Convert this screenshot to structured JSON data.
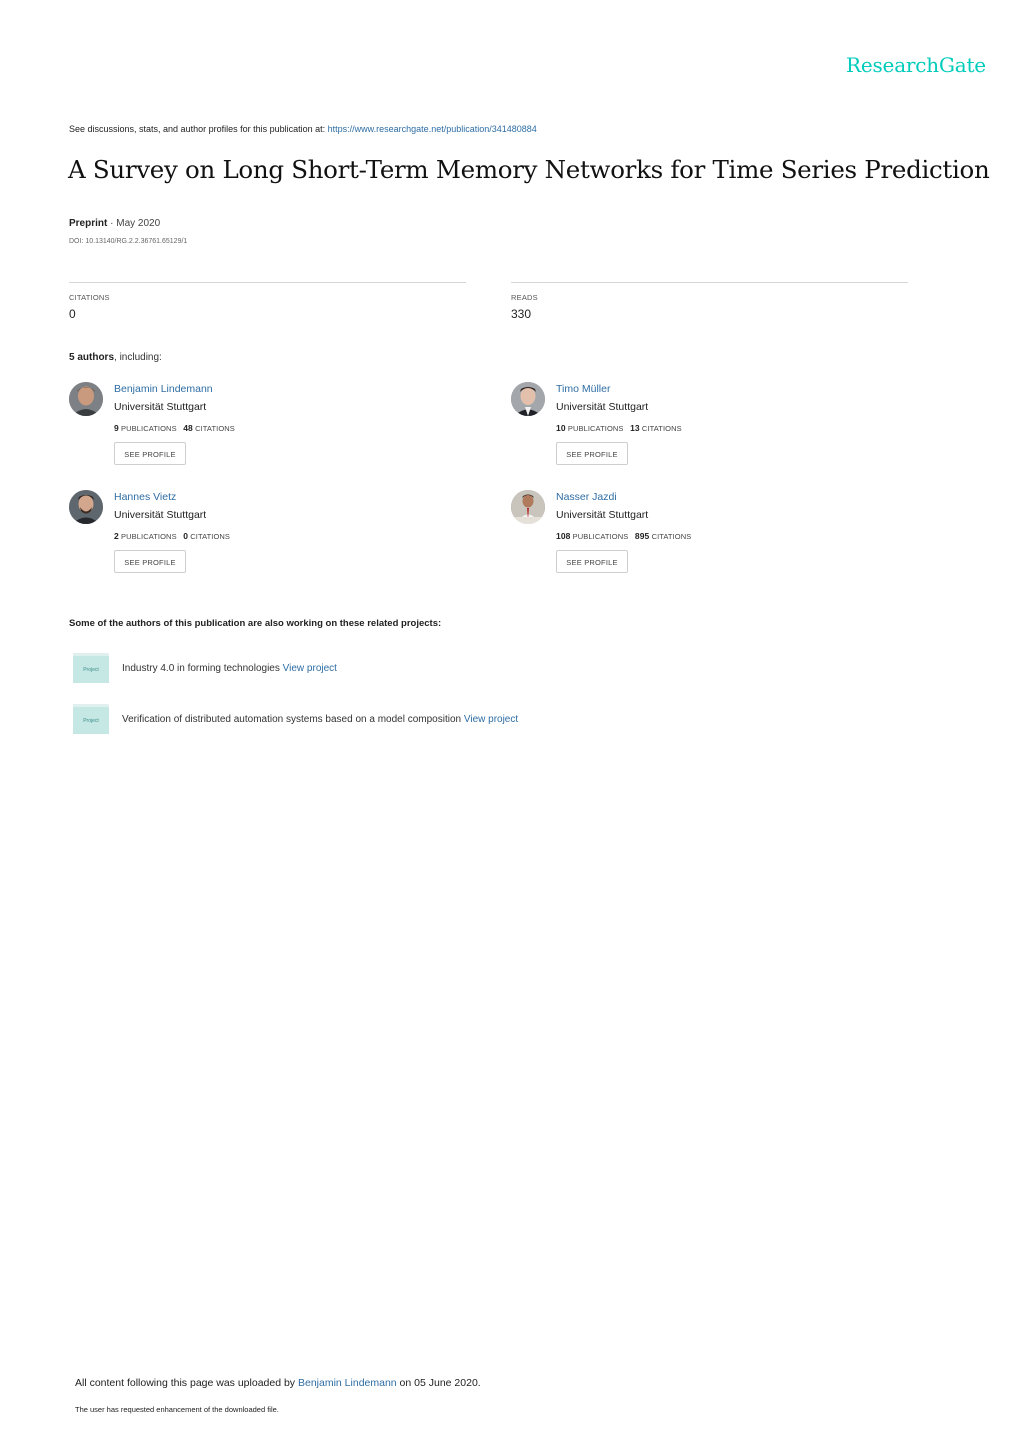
{
  "brand": {
    "logo_text": "ResearchGate",
    "accent_color": "#00ccbb",
    "link_color": "#2e6da4"
  },
  "header": {
    "see_discussions_text": "See discussions, stats, and author profiles for this publication at: ",
    "publication_url": "https://www.researchgate.net/publication/341480884"
  },
  "publication": {
    "title": "A Survey on Long Short-Term Memory Networks for Time Series Prediction",
    "type": "Preprint",
    "date_sep": " · ",
    "date": "May 2020",
    "doi": "DOI: 10.13140/RG.2.2.36761.65129/1"
  },
  "stats": {
    "citations_label": "CITATIONS",
    "citations_value": "0",
    "reads_label": "READS",
    "reads_value": "330"
  },
  "authors_section": {
    "count_bold": "5 authors",
    "suffix": ", including:",
    "publications_label": "PUBLICATIONS",
    "citations_label": "CITATIONS",
    "see_profile_label": "SEE PROFILE",
    "authors": [
      {
        "name": "Benjamin Lindemann",
        "institution": "Universität Stuttgart",
        "publications": "9",
        "citations": "48"
      },
      {
        "name": "Timo Müller",
        "institution": "Universität Stuttgart",
        "publications": "10",
        "citations": "13"
      },
      {
        "name": "Hannes Vietz",
        "institution": "Universität Stuttgart",
        "publications": "2",
        "citations": "0"
      },
      {
        "name": "Nasser Jazdi",
        "institution": "Universität Stuttgart",
        "publications": "108",
        "citations": "895"
      }
    ]
  },
  "projects_section": {
    "heading": "Some of the authors of this publication are also working on these related projects:",
    "icon_label": "Project",
    "view_label": "View project",
    "projects": [
      {
        "title": "Industry 4.0 in forming technologies"
      },
      {
        "title": "Verification of distributed automation systems based on a model composition"
      }
    ]
  },
  "footer": {
    "uploaded_prefix": "All content following this page was uploaded by ",
    "uploader": "Benjamin Lindemann",
    "uploaded_suffix": " on 05 June 2020.",
    "enhancement_note": "The user has requested enhancement of the downloaded file."
  }
}
